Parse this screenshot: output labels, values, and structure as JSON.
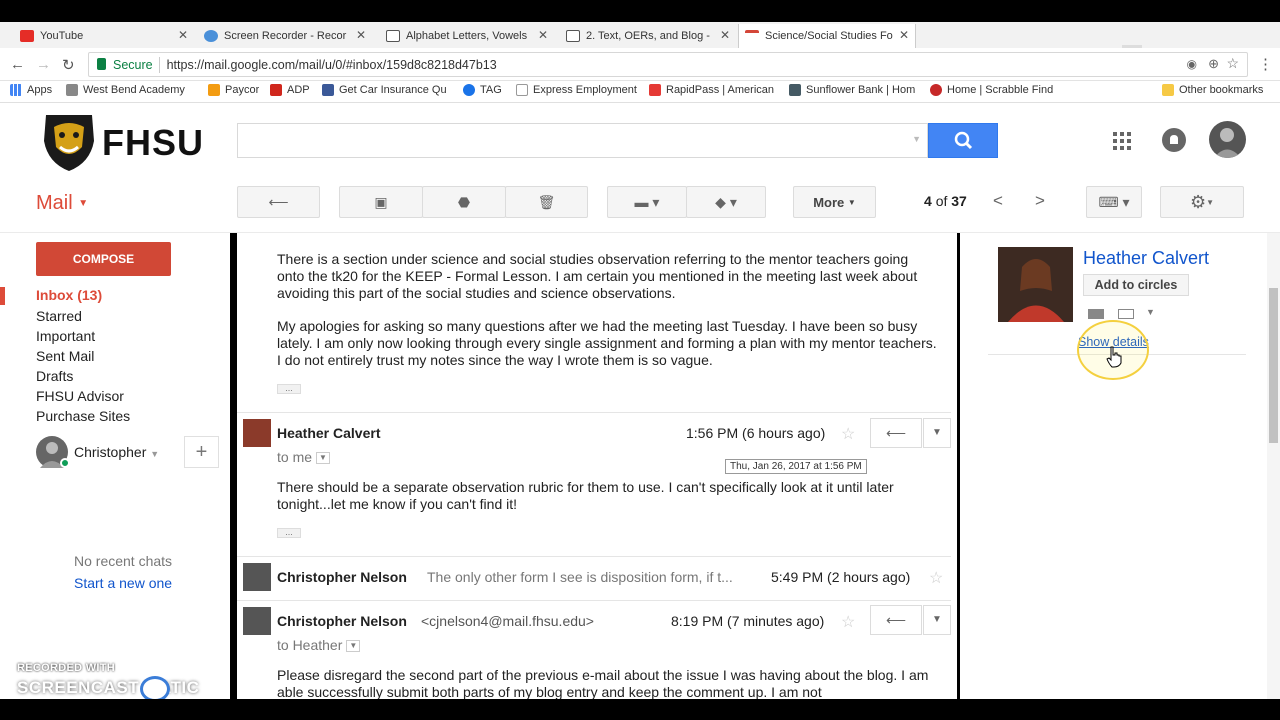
{
  "browser": {
    "tabs": [
      {
        "title": "YouTube",
        "icon_color": "#e52d27"
      },
      {
        "title": "Screen Recorder - Recor",
        "icon_color": "#4a90d9"
      },
      {
        "title": "Alphabet Letters, Vowels",
        "icon_color": "#555555"
      },
      {
        "title": "2. Text, OERs, and Blog -",
        "icon_color": "#555555"
      },
      {
        "title": "Science/Social Studies Fo",
        "icon_color": "#d44638"
      }
    ],
    "secure_label": "Secure",
    "url": "https://mail.google.com/mail/u/0/#inbox/159d8c8218d47b13",
    "bookmarks": [
      {
        "label": "Apps",
        "icon": "apps-icon"
      },
      {
        "label": "West Bend Academy",
        "icon": "bookmark-icon"
      },
      {
        "label": "Paycor",
        "icon": "paycor-icon"
      },
      {
        "label": "ADP",
        "icon": "adp-icon"
      },
      {
        "label": "Get Car Insurance Qu",
        "icon": "bookmark-icon"
      },
      {
        "label": "TAG",
        "icon": "bookmark-icon"
      },
      {
        "label": "Express Employment",
        "icon": "bookmark-icon"
      },
      {
        "label": "RapidPass | American",
        "icon": "bookmark-icon"
      },
      {
        "label": "Sunflower Bank | Hom",
        "icon": "bookmark-icon"
      },
      {
        "label": "Home | Scrabble Find",
        "icon": "bookmark-icon"
      }
    ],
    "other_bookmarks": "Other bookmarks"
  },
  "header": {
    "logo_text": "FHSU",
    "search_value": ""
  },
  "toolbar": {
    "mail_label": "Mail",
    "more_label": "More",
    "pager_current": "4",
    "pager_of": "of",
    "pager_total": "37"
  },
  "sidebar": {
    "compose": "COMPOSE",
    "items": [
      {
        "label": "Inbox (13)",
        "active": true
      },
      {
        "label": "Starred"
      },
      {
        "label": "Important"
      },
      {
        "label": "Sent Mail"
      },
      {
        "label": "Drafts"
      },
      {
        "label": "FHSU Advisor"
      },
      {
        "label": "Purchase Sites"
      }
    ],
    "hangouts_user": "Christopher",
    "no_recent_chats": "No recent chats",
    "start_new": "Start a new one"
  },
  "thread": {
    "para1": "There is a section under science and social studies observation referring to the mentor teachers going onto the tk20 for the KEEP - Formal Lesson. I am certain you mentioned in the meeting last week about avoiding this part of the social studies and science observations.",
    "para2": "My apologies for asking so many questions after we had the meeting last Tuesday. I have been so busy lately. I am only now looking through every single assignment and forming a plan with my mentor teachers. I do not entirely trust my notes since the way I wrote them is so vague.",
    "dots": "...",
    "messages": [
      {
        "sender": "Heather Calvert",
        "time": "1:56 PM (6 hours ago)",
        "to": "to me",
        "tooltip": "Thu, Jan 26, 2017 at 1:56 PM",
        "body": "There should be a separate observation rubric for them to use. I can't specifically look at it until later tonight...let me know if you can't find it!"
      },
      {
        "sender": "Christopher Nelson",
        "snippet": "The only other form I see is disposition form, if t...",
        "time": "5:49 PM (2 hours ago)"
      },
      {
        "sender": "Christopher Nelson",
        "email": "<cjnelson4@mail.fhsu.edu>",
        "time": "8:19 PM (7 minutes ago)",
        "to": "to Heather",
        "body": "Please disregard the second part of the previous e-mail about the issue I was having about the blog. I am able successfully submit both parts of my blog entry and keep the comment up. I am not"
      }
    ]
  },
  "contact": {
    "name": "Heather Calvert",
    "add_circles": "Add to circles",
    "show_details": "Show details"
  },
  "watermark": {
    "line1": "RECORDED WITH",
    "line2": "SCREENCAST   MATIC"
  },
  "colors": {
    "accent_red": "#dd4b39",
    "compose_red": "#d14836",
    "search_blue": "#4285f4",
    "link_blue": "#1155cc",
    "secure_green": "#0b8043"
  }
}
